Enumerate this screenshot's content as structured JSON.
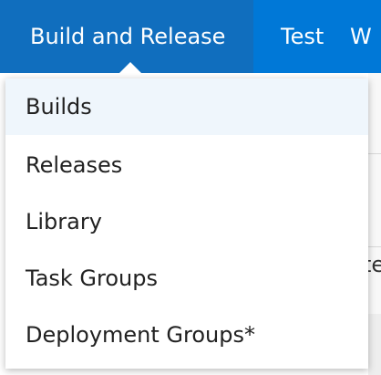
{
  "nav": {
    "items": [
      {
        "label": "Build and Release",
        "active": true
      },
      {
        "label": "Test"
      },
      {
        "label": "W"
      }
    ]
  },
  "dropdown": {
    "items": [
      {
        "label": "Builds",
        "selected": true
      },
      {
        "label": "Releases"
      },
      {
        "label": "Library"
      },
      {
        "label": "Task Groups"
      },
      {
        "label": "Deployment Groups*"
      }
    ]
  },
  "background": {
    "partial_text": "te"
  },
  "colors": {
    "nav_background": "#0078d7",
    "nav_active_background": "#106ebe",
    "nav_text": "#ffffff",
    "menu_selected_background": "#eff6fc",
    "menu_text": "#212121"
  }
}
